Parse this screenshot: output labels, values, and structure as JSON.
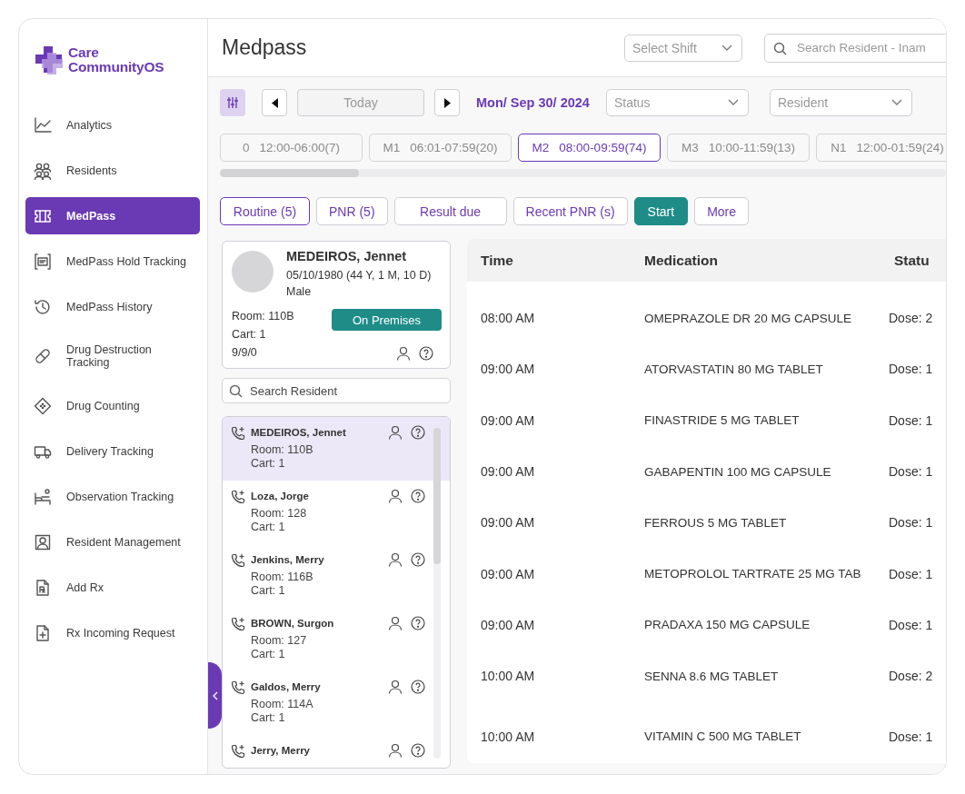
{
  "brand": {
    "line1": "Care",
    "line2": "CommunityOS"
  },
  "sidebar": {
    "items": [
      {
        "label": "Analytics",
        "kind": "chart",
        "selected": false
      },
      {
        "label": "Residents",
        "kind": "people",
        "selected": false
      },
      {
        "label": "MedPass",
        "kind": "ticket",
        "selected": true
      },
      {
        "label": "MedPass Hold Tracking",
        "kind": "scan",
        "selected": false
      },
      {
        "label": "MedPass History",
        "kind": "history",
        "selected": false
      },
      {
        "label": "Drug Destruction Tracking",
        "kind": "pill",
        "selected": false
      },
      {
        "label": "Drug Counting",
        "kind": "tablet",
        "selected": false
      },
      {
        "label": "Delivery Tracking",
        "kind": "truck",
        "selected": false
      },
      {
        "label": "Observation Tracking",
        "kind": "bed",
        "selected": false
      },
      {
        "label": "Resident Management",
        "kind": "portrait",
        "selected": false
      },
      {
        "label": "Add Rx",
        "kind": "doc",
        "selected": false
      },
      {
        "label": "Rx Incoming Request",
        "kind": "docplus",
        "selected": false
      }
    ]
  },
  "header": {
    "title": "Medpass",
    "shift_select": {
      "placeholder": "Select Shift"
    },
    "search": {
      "placeholder": "Search Resident - Inam"
    }
  },
  "toolbar": {
    "today": "Today",
    "date": "Mon/ Sep 30/ 2024",
    "status": {
      "placeholder": "Status"
    },
    "resident": {
      "placeholder": "Resident"
    }
  },
  "shifts": [
    {
      "code": "0",
      "range": "12:00-06:00(7)",
      "selected": false
    },
    {
      "code": "M1",
      "range": "06:01-07:59(20)",
      "selected": false
    },
    {
      "code": "M2",
      "range": "08:00-09:59(74)",
      "selected": true
    },
    {
      "code": "M3",
      "range": "10:00-11:59(13)",
      "selected": false
    },
    {
      "code": "N1",
      "range": "12:00-01:59(24)",
      "selected": false
    }
  ],
  "filters": [
    {
      "label": "Routine (5)",
      "selected": true
    },
    {
      "label": "PNR (5)",
      "selected": false
    },
    {
      "label": "Result due",
      "selected": false
    },
    {
      "label": "Recent PNR (s)",
      "selected": false
    }
  ],
  "actions": [
    {
      "label": "Start",
      "kind": "primary"
    },
    {
      "label": "More",
      "kind": "outline"
    }
  ],
  "resident_card": {
    "name": "MEDEIROS, Jennet",
    "dob": "05/10/1980 (44 Y, 1 M, 10 D)",
    "gender": "Male",
    "room": "Room: 110B",
    "cart": "Cart: 1",
    "counts": "9/9/0",
    "status": "On Premises"
  },
  "resident_search": {
    "placeholder": "Search Resident"
  },
  "residents": [
    {
      "name": "MEDEIROS, Jennet",
      "room": "Room: 110B",
      "cart": "Cart: 1",
      "selected": true
    },
    {
      "name": "Loza, Jorge",
      "room": "Room: 128",
      "cart": "Cart: 1",
      "selected": false
    },
    {
      "name": "Jenkins, Merry",
      "room": "Room: 116B",
      "cart": "Cart: 1",
      "selected": false
    },
    {
      "name": "BROWN, Surgon",
      "room": "Room: 127",
      "cart": "Cart: 1",
      "selected": false
    },
    {
      "name": "Galdos, Merry",
      "room": "Room: 114A",
      "cart": "Cart: 1",
      "selected": false
    },
    {
      "name": "Jerry, Merry",
      "selected": false
    }
  ],
  "table": {
    "columns": [
      "Time",
      "Medication",
      "Statu"
    ],
    "rows": [
      {
        "time": "08:00 AM",
        "medication": "OMEPRAZOLE DR 20 MG CAPSULE",
        "status": "Dose: 2"
      },
      {
        "time": "09:00 AM",
        "medication": "ATORVASTATIN 80 MG TABLET",
        "status": "Dose: 1"
      },
      {
        "time": "09:00 AM",
        "medication": "FINASTRIDE 5 MG TABLET",
        "status": "Dose: 1"
      },
      {
        "time": "09:00 AM",
        "medication": "GABAPENTIN 100 MG CAPSULE",
        "status": "Dose: 1"
      },
      {
        "time": "09:00 AM",
        "medication": "FERROUS 5 MG TABLET",
        "status": "Dose: 1"
      },
      {
        "time": "09:00 AM",
        "medication": "METOPROLOL TARTRATE 25 MG TAB",
        "status": "Dose: 1"
      },
      {
        "time": "09:00 AM",
        "medication": "PRADAXA 150 MG CAPSULE",
        "status": "Dose: 1"
      },
      {
        "time": "10:00 AM",
        "medication": "SENNA 8.6 MG TABLET",
        "status": "Dose: 2"
      },
      {
        "time": "10:00 AM",
        "medication": "VITAMIN C 500 MG TABLET",
        "status": "Dose: 1"
      }
    ]
  }
}
